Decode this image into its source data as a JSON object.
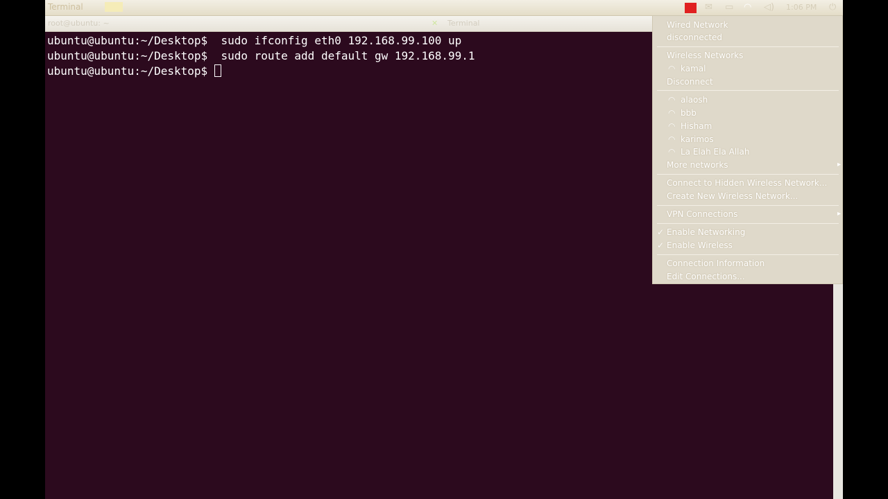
{
  "panel": {
    "app_name": "Terminal",
    "clock": "1:06 PM",
    "icons": [
      "battery-icon",
      "mail-icon",
      "window-icon",
      "wifi-icon",
      "volume-icon",
      "power-icon"
    ],
    "accent_color": "#e02020"
  },
  "tabs": [
    {
      "label": "root@ubuntu: ~"
    },
    {
      "label": "Terminal"
    }
  ],
  "terminal": {
    "prompt": "ubuntu@ubuntu:~/Desktop$",
    "lines": [
      {
        "command": "  sudo ifconfig eth0 192.168.99.100 up"
      },
      {
        "command": "  sudo route add default gw 192.168.99.1"
      },
      {
        "command": " "
      }
    ],
    "background_color": "#2c0a1e"
  },
  "menu": {
    "wired_header": "Wired Network",
    "wired_status": "disconnected",
    "wireless_header": "Wireless Networks",
    "connected_network": "kamal",
    "disconnect": "Disconnect",
    "networks": [
      "alaosh",
      "bbb",
      "Hisham",
      "karimos",
      "La Elah Ela Allah"
    ],
    "more_networks": "More networks",
    "connect_hidden": "Connect to Hidden Wireless Network...",
    "create_new": "Create New Wireless Network...",
    "vpn": "VPN Connections",
    "enable_networking": "Enable Networking",
    "enable_wireless": "Enable Wireless",
    "connection_info": "Connection Information",
    "edit_connections": "Edit Connections..."
  }
}
